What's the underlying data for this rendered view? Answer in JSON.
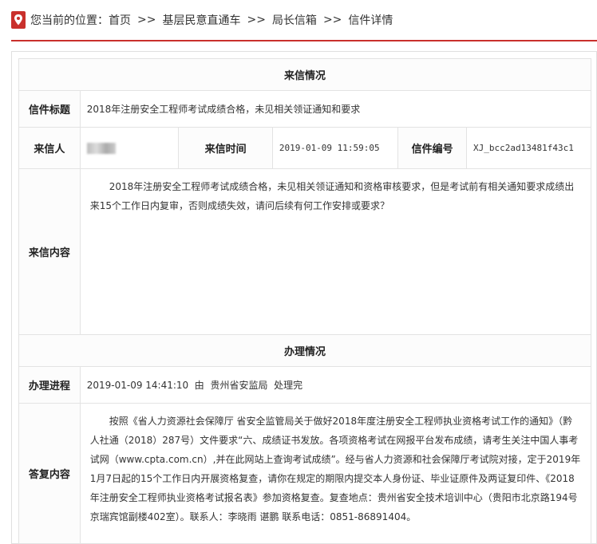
{
  "breadcrumb": {
    "prefix": "您当前的位置：",
    "items": [
      "首页",
      "基层民意直通车",
      "局长信箱",
      "信件详情"
    ],
    "separator": ">>"
  },
  "letter": {
    "section_title": "来信情况",
    "title_label": "信件标题",
    "title_value": "2018年注册安全工程师考试成绩合格，未见相关领证通知和要求",
    "sender_label": "来信人",
    "time_label": "来信时间",
    "time_value": "2019-01-09 11:59:05",
    "id_label": "信件编号",
    "id_value": "XJ_bcc2ad13481f43c1",
    "content_label": "来信内容",
    "content_value": "2018年注册安全工程师考试成绩合格，未见相关领证通知和资格审核要求，但是考试前有相关通知要求成绩出来15个工作日内复审，否则成绩失效，请问后续有何工作安排或要求？"
  },
  "handling": {
    "section_title": "办理情况",
    "progress_label": "办理进程",
    "progress_value": "2019-01-09 14:41:10  由  贵州省安监局  处理完",
    "reply_label": "答复内容",
    "reply_value": "按照《省人力资源社会保障厅 省安全监管局关于做好2018年度注册安全工程师执业资格考试工作的通知》（黔人社通（2018）287号）文件要求“六、成绩证书发放。各项资格考试在网报平台发布成绩，请考生关注中国人事考试网（www.cpta.com.cn）,并在此网站上查询考试成绩”。经与省人力资源和社会保障厅考试院对接，定于2019年1月7日起的15个工作日内开展资格复查，请你在规定的期限内提交本人身份证、毕业证原件及两证复印件、《2018年注册安全工程师执业资格考试报名表》参加资格复查。复查地点：贵州省安全技术培训中心（贵阳市北京路194号京瑞宾馆副楼402室）。联系人：李晓雨 谌鹏 联系电话：0851-86891404。"
  },
  "colors": {
    "accent": "#c9302c",
    "border": "#e3e3e3"
  }
}
